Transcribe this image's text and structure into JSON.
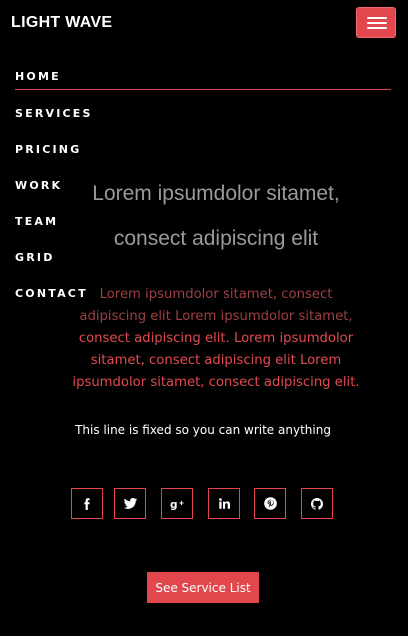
{
  "brand": "LIGHT WAVE",
  "nav": {
    "items": [
      "HOME",
      "SERVICES",
      "PRICING",
      "WORK",
      "TEAM",
      "GRID",
      "CONTACT"
    ]
  },
  "hero": {
    "title_line1": "Lorem ipsumdolor sitamet,",
    "title_line2": "consect adipiscing elit",
    "para_line1": "Lorem ipsumdolor sitamet, consect",
    "para_line2": "adipiscing elit Lorem ipsumdolor sitamet,",
    "para_line3": "consect adipiscing elit. Lorem ipsumdolor",
    "para_line4": "sitamet, consect adipiscing elit Lorem",
    "para_line5": "ipsumdolor sitamet, consect adipiscing elit.",
    "fixed_line": "This line is fixed so you can write anything"
  },
  "social": [
    {
      "icon": "facebook-icon"
    },
    {
      "icon": "twitter-icon"
    },
    {
      "icon": "google-plus-icon"
    },
    {
      "icon": "linkedin-icon"
    },
    {
      "icon": "pinterest-icon"
    },
    {
      "icon": "github-icon"
    }
  ],
  "cta": {
    "label": "See Service List"
  },
  "colors": {
    "background": "#000000",
    "accent": "#e2474d",
    "hero_title": "#9a9a9a",
    "text": "#ffffff"
  }
}
